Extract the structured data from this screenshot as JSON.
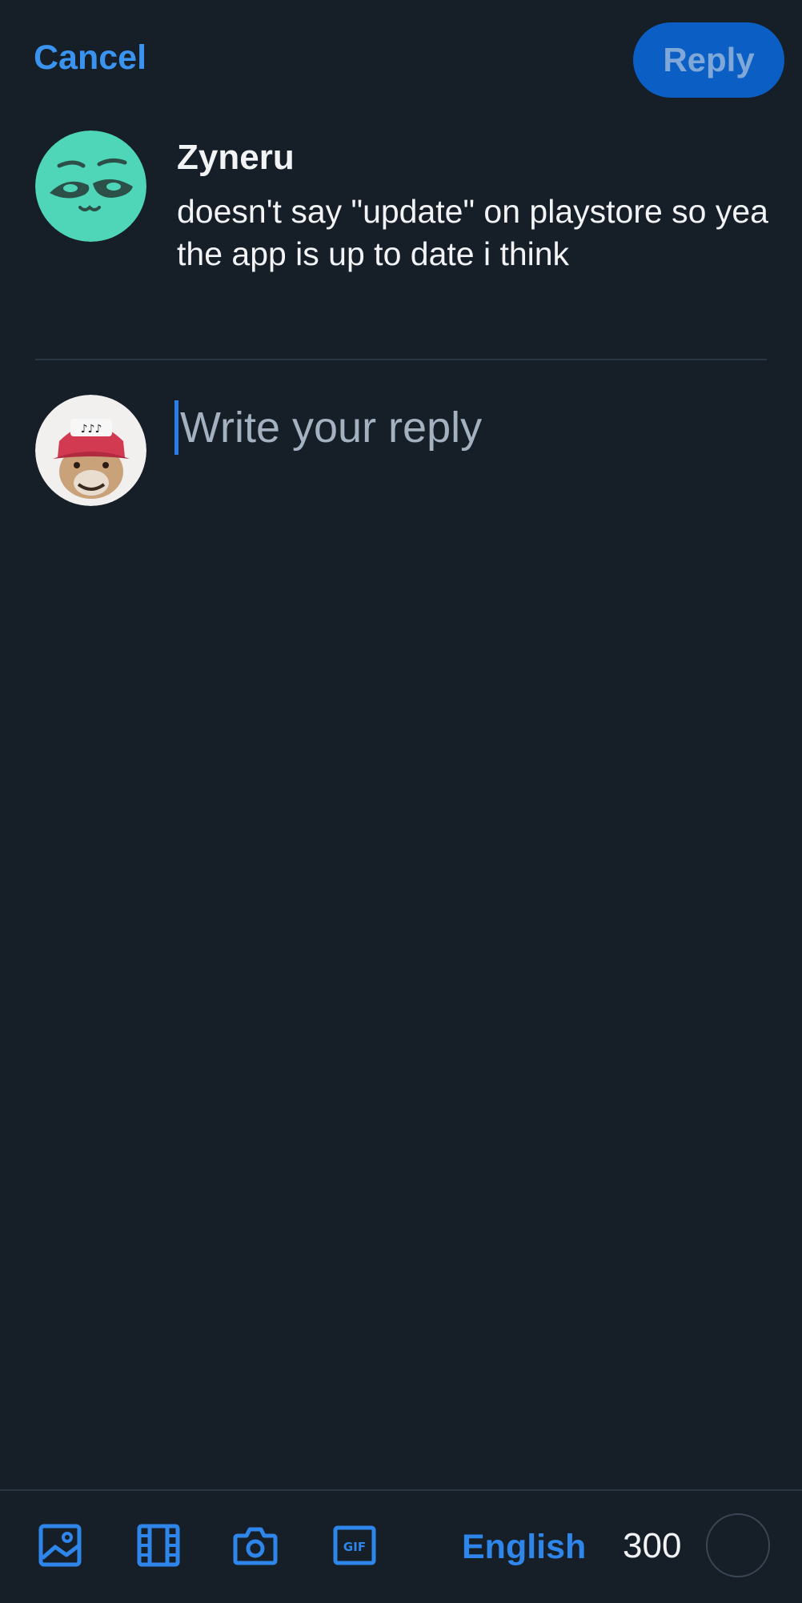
{
  "header": {
    "cancel_label": "Cancel",
    "reply_label": "Reply"
  },
  "parent_post": {
    "author": "Zyneru",
    "text": "doesn't say \"update\" on playstore so yea the app is up to date i think",
    "avatar_icon": "avatar-mint-face-icon"
  },
  "compose": {
    "placeholder": "Write your reply",
    "value": "",
    "avatar_icon": "user-avatar-icon"
  },
  "toolbar": {
    "icons": [
      "image-icon",
      "video-icon",
      "camera-icon",
      "gif-icon"
    ],
    "gif_text": "GIF",
    "language": "English",
    "char_remaining": "300"
  },
  "colors": {
    "background": "#161e27",
    "accent": "#3b93f0",
    "reply_button": "#0a5ec4",
    "divider": "#2b3644"
  }
}
